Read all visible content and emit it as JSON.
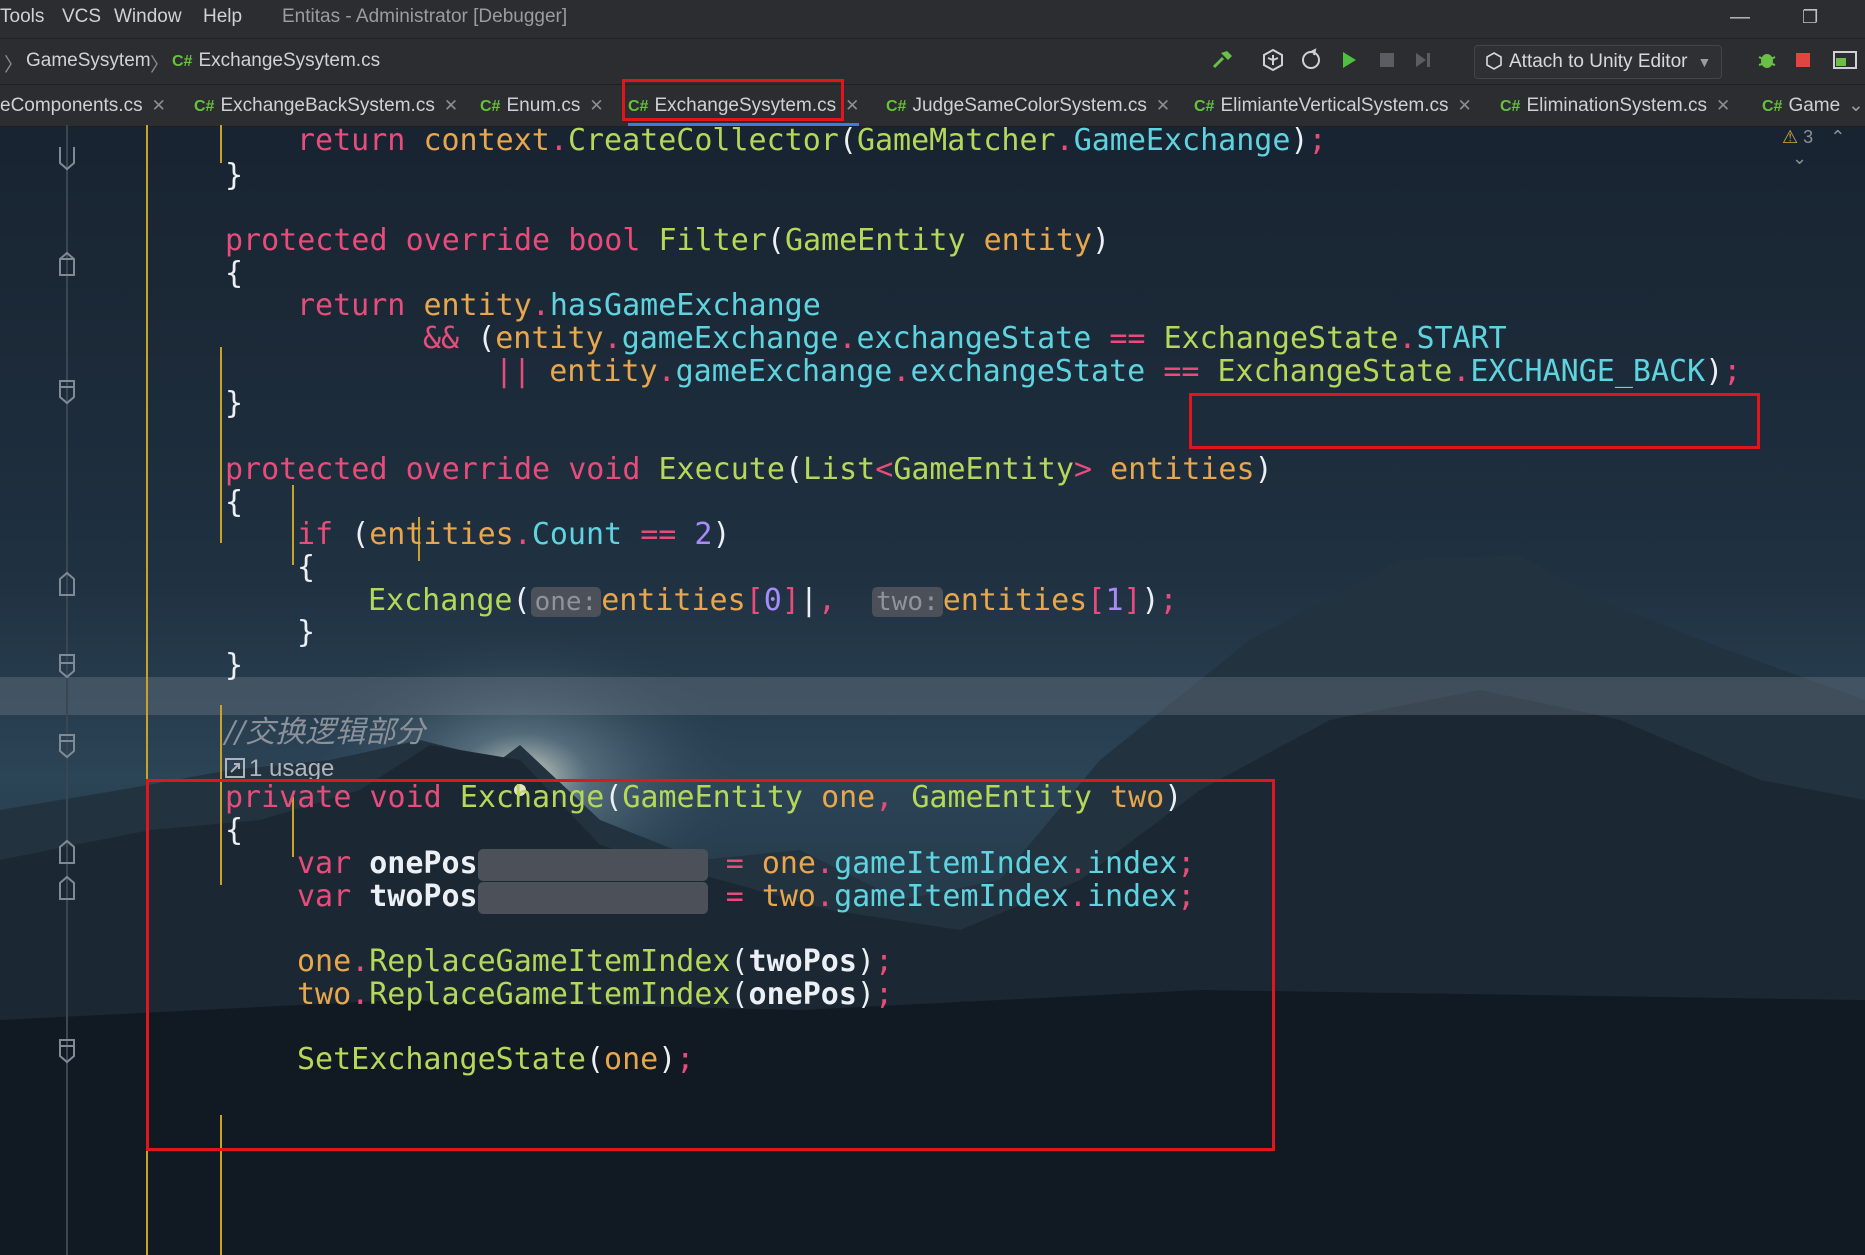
{
  "menu": {
    "items": [
      "Tools",
      "VCS",
      "Window",
      "Help"
    ],
    "window_title": "Entitas - Administrator [Debugger]"
  },
  "breadcrumb": {
    "project": "GameSysytem",
    "file": "ExchangeSysytem.cs",
    "lang_badge": "C#"
  },
  "toolbar": {
    "attach_label": "Attach to Unity Editor"
  },
  "tabs": [
    {
      "label": "eComponents.cs"
    },
    {
      "label": "ExchangeBackSystem.cs"
    },
    {
      "label": "Enum.cs"
    },
    {
      "label": "ExchangeSysytem.cs",
      "active": true
    },
    {
      "label": "JudgeSameColorSystem.cs"
    },
    {
      "label": "ElimianteVerticalSystem.cs"
    },
    {
      "label": "EliminationSystem.cs"
    },
    {
      "label": "Game"
    }
  ],
  "inspection": {
    "warnings": "3"
  },
  "code": {
    "comment": "//交换逻辑部分",
    "usage": "1 usage",
    "hint_one": "one:",
    "hint_two": "two:"
  },
  "colors": {
    "highlight_box": "#e0161c",
    "keyword": "#e74c7a",
    "type": "#b5d85a",
    "identifier": "#e8a64d",
    "property": "#5fd4e0"
  }
}
